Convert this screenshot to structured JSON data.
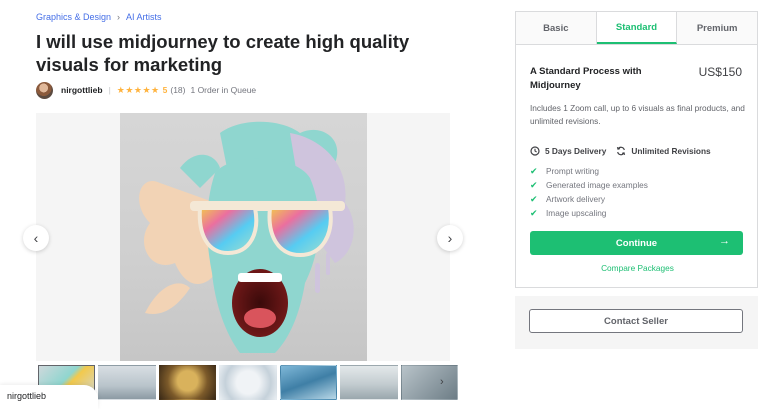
{
  "breadcrumb": {
    "category": "Graphics & Design",
    "subcategory": "AI Artists"
  },
  "gig": {
    "title": "I will use midjourney to create high quality visuals for marketing",
    "seller": "nirgottlieb",
    "stars": "★★★★★",
    "rating": "5",
    "reviews": "(18)",
    "queue": "1 Order in Queue"
  },
  "gallery": {
    "thumbnail_count": 7,
    "active_index": 0
  },
  "seller_tag": "nirgottlieb",
  "packages": {
    "tabs": [
      "Basic",
      "Standard",
      "Premium"
    ],
    "active_tab": "Standard",
    "name": "A Standard Process with Midjourney",
    "price": "US$150",
    "description": "Includes 1 Zoom call, up to 6 visuals as final products, and unlimited revisions.",
    "delivery": "5 Days Delivery",
    "revisions": "Unlimited Revisions",
    "features": [
      "Prompt writing",
      "Generated image examples",
      "Artwork delivery",
      "Image upscaling"
    ],
    "continue_label": "Continue",
    "compare_label": "Compare Packages"
  },
  "contact_label": "Contact Seller",
  "colors": {
    "accent": "#1dbf73",
    "link": "#446ee7",
    "star": "#ffb33e"
  },
  "icons": {
    "breadcrumb_separator": "chevron-right-icon",
    "prev": "chevron-left-icon",
    "next": "chevron-right-icon",
    "delivery": "clock-icon",
    "revisions": "refresh-icon",
    "feature": "check-icon",
    "continue": "arrow-right-icon"
  }
}
